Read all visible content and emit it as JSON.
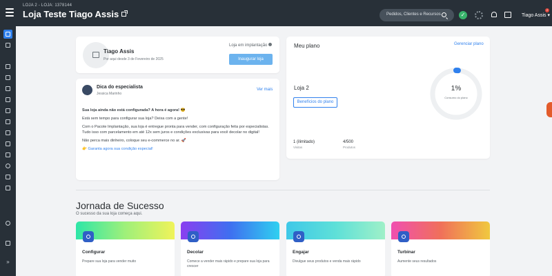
{
  "header": {
    "store_subtitle": "LOJA 2 - LOJA: 1378144",
    "store_title": "Loja Teste Tiago Assis",
    "search_placeholder": "Pedidos, Clientes e Recursos",
    "user_name": "Tiago Assis",
    "notification_count": "2",
    "icons": [
      "menu-icon",
      "external-link-icon",
      "search-icon",
      "check-icon",
      "bell-icon",
      "chat-icon",
      "chevron-down-icon"
    ]
  },
  "sidebar": {
    "icons": [
      "home-icon",
      "store-icon",
      "cart-icon",
      "tag-icon",
      "box-icon",
      "monitor-icon",
      "flag-icon",
      "chat-icon",
      "mail-icon",
      "phone-icon",
      "document-icon",
      "help-icon",
      "lock-icon",
      "mobile-icon",
      "settings-icon",
      "support-icon",
      "expand-icon"
    ]
  },
  "store_card": {
    "owner_name": "Tiago Assis",
    "since": "Por aqui desde 3 de Fevereiro de 2025",
    "status": "Loja em implantação",
    "open_button": "Inaugurar loja"
  },
  "tip_card": {
    "title": "Dica do especialista",
    "author": "Jessica Marinho",
    "see_more": "Ver mais",
    "heading": "Sua loja ainda não está configurada? A hora é agora! 😎",
    "p1": "Está sem tempo para configurar sua loja? Deixa com a gente!",
    "p2": "Com o Pacote Implantação, sua loja é entregue pronta para vender, com configuração feita por especialistas. Tudo isso com parcelamento em até 12x sem juros e condições exclusivas para você decolar no digital!",
    "p3": "Não perca mais dinheiro, coloque seu e-commerce no ar. 🚀",
    "link": "👉 Garanta agora sua condição especial!"
  },
  "plan_card": {
    "title": "Meu plano",
    "manage": "Gerenciar plano",
    "plan_name": "Loja 2",
    "benefits_button": "Benefícios do plano",
    "usage_value": "1%",
    "usage_fraction": 0.01,
    "usage_label": "Consumo do plano",
    "visits_value": "1 (ilimitado)",
    "visits_label": "Visitas",
    "products_value": "4/500",
    "products_label": "Produtos",
    "accent": "#2f80ed"
  },
  "journey": {
    "title": "Jornada de Sucesso",
    "subtitle": "O sucesso da sua loja começa aqui.",
    "steps": [
      {
        "title": "Configurar",
        "desc": "Prepare sua loja para vender muito",
        "icon": "gear-icon"
      },
      {
        "title": "Decolar",
        "desc": "Comece a vender mais rápido e prepare sua loja para crescer",
        "icon": "rocket-icon"
      },
      {
        "title": "Engajar",
        "desc": "Divulgue seus produtos e venda mais rápido",
        "icon": "megaphone-icon"
      },
      {
        "title": "Turbinar",
        "desc": "Aumente seus resultados",
        "icon": "chart-icon"
      }
    ]
  }
}
